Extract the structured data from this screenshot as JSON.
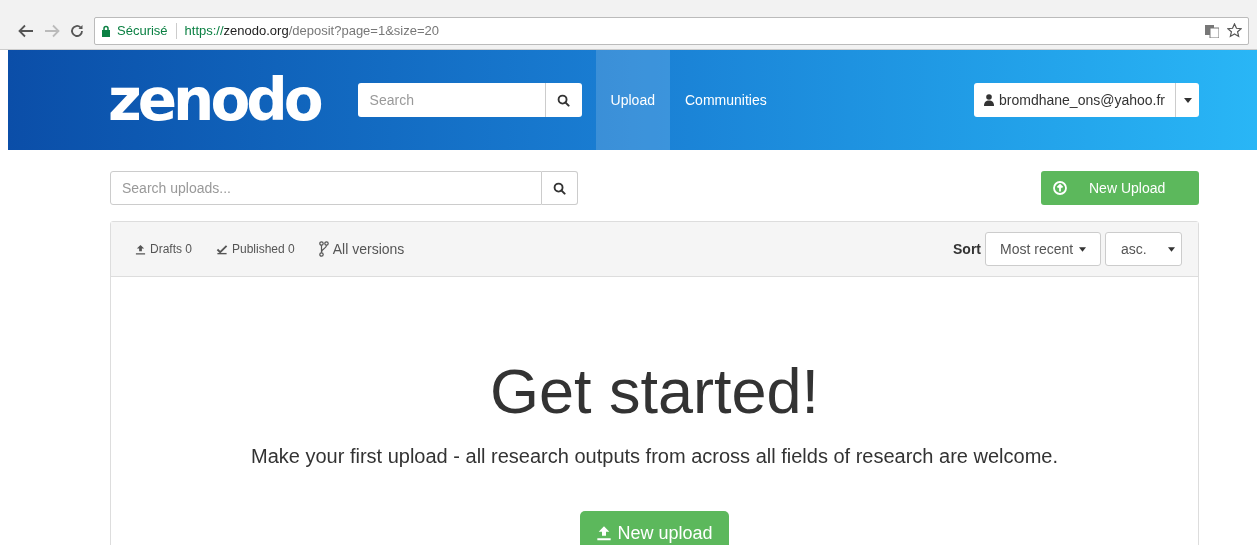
{
  "browser": {
    "security_label": "Sécurisé",
    "url": {
      "scheme": "https://",
      "host": "zenodo.org",
      "path": "/deposit?page=1&size=20"
    }
  },
  "header": {
    "logo": "zenodo",
    "search": {
      "placeholder": "Search"
    },
    "nav": [
      {
        "label": "Upload",
        "selected": true
      },
      {
        "label": "Communities",
        "selected": false
      }
    ],
    "user": "bromdhane_ons@yahoo.fr"
  },
  "toolbar": {
    "search": {
      "placeholder": "Search uploads..."
    },
    "new_upload": "New Upload"
  },
  "filters": [
    {
      "kind": "upload",
      "label": "Drafts 0"
    },
    {
      "kind": "check",
      "label": "Published 0"
    },
    {
      "kind": "branch",
      "label": "All versions"
    }
  ],
  "sort": {
    "label": "Sort",
    "field": "Most recent",
    "order": "asc."
  },
  "empty": {
    "title": "Get started!",
    "message": "Make your first upload - all research outputs from across all fields of research are welcome.",
    "button": "New upload"
  }
}
